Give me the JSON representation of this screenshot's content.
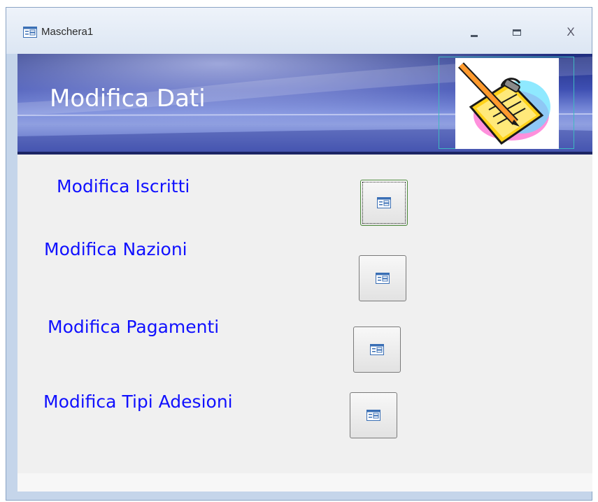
{
  "window": {
    "title": "Maschera1",
    "icon": "form-icon",
    "controls": [
      "minimize-icon",
      "maximize-icon",
      "close-icon"
    ],
    "close_label": "X"
  },
  "header": {
    "title": "Modifica Dati",
    "logo": "clipboard-pencil-clipart"
  },
  "items": [
    {
      "label": "Modifica Iscritti",
      "button_icon": "form-icon",
      "focused": true
    },
    {
      "label": "Modifica Nazioni",
      "button_icon": "form-icon",
      "focused": false
    },
    {
      "label": "Modifica Pagamenti",
      "button_icon": "form-icon",
      "focused": false
    },
    {
      "label": "Modifica Tipi Adesioni",
      "button_icon": "form-icon",
      "focused": false
    }
  ],
  "colors": {
    "label_text": "#1010ff",
    "header_dark": "#1f2d7e",
    "header_light": "#8f9fe0",
    "form_background": "#f0f0f0"
  }
}
